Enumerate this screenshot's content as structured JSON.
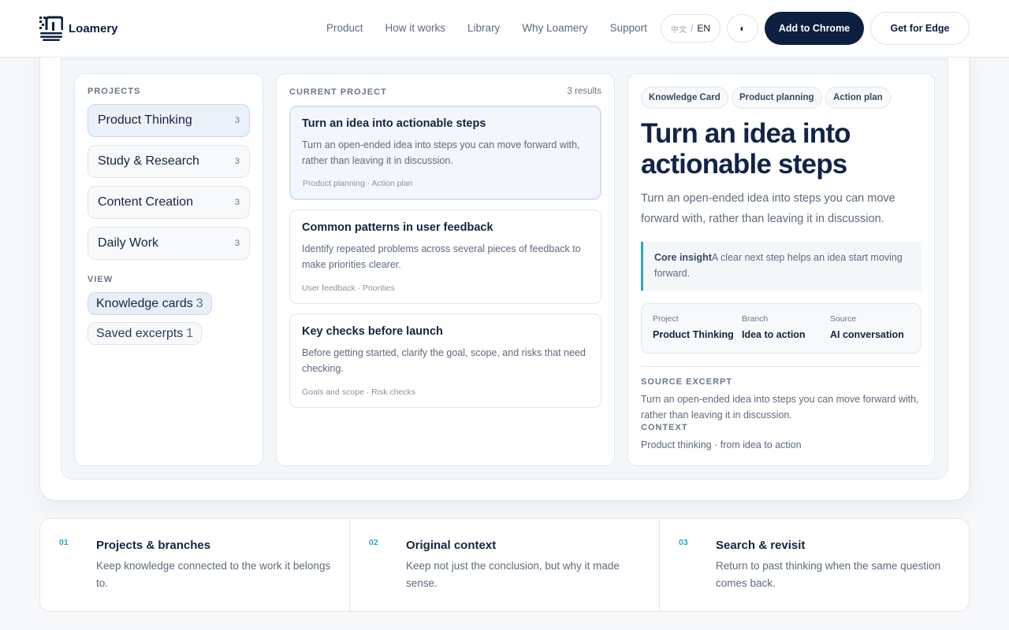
{
  "brand": {
    "name": "Loamery"
  },
  "nav": [
    "Product",
    "How it works",
    "Library",
    "Why Loamery",
    "Support"
  ],
  "language": {
    "other": "中文",
    "separator": "/",
    "current": "EN"
  },
  "theme_toggle": "◐",
  "header_buttons": {
    "chrome": "Add to Chrome",
    "edge": "Get for Edge"
  },
  "projects": {
    "label": "PROJECTS",
    "items": [
      {
        "name": "Product Thinking",
        "count": "3",
        "active": true
      },
      {
        "name": "Study & Research",
        "count": "3",
        "active": false
      },
      {
        "name": "Content Creation",
        "count": "3",
        "active": false
      },
      {
        "name": "Daily Work",
        "count": "3",
        "active": false
      }
    ]
  },
  "view": {
    "label": "VIEW",
    "options": [
      {
        "name": "Knowledge cards",
        "count": "3",
        "active": true
      },
      {
        "name": "Saved excerpts",
        "count": "1",
        "active": false
      }
    ]
  },
  "current_project": {
    "label": "CURRENT PROJECT",
    "results": "3 results",
    "cards": [
      {
        "title": "Turn an idea into actionable steps",
        "description": "Turn an open-ended idea into steps you can move forward with, rather than leaving it in discussion.",
        "meta": "Product planning · Action plan",
        "active": true
      },
      {
        "title": "Common patterns in user feedback",
        "description": "Identify repeated problems across several pieces of feedback to make priorities clearer.",
        "meta": "User feedback · Priorities",
        "active": false
      },
      {
        "title": "Key checks before launch",
        "description": "Before getting started, clarify the goal, scope, and risks that need checking.",
        "meta": "Goals and scope · Risk checks",
        "active": false
      }
    ]
  },
  "detail": {
    "tags": [
      "Knowledge Card",
      "Product planning",
      "Action plan"
    ],
    "title": "Turn an idea into actionable steps",
    "summary": "Turn an open-ended idea into steps you can move forward with, rather than leaving it in discussion.",
    "insight_label": "Core insight",
    "insight_text": "A clear next step helps an idea start moving forward.",
    "meta": [
      {
        "label": "Project",
        "value": "Product Thinking"
      },
      {
        "label": "Branch",
        "value": "Idea to action"
      },
      {
        "label": "Source",
        "value": "AI conversation"
      }
    ],
    "source_label": "SOURCE EXCERPT",
    "source_text": "Turn an open-ended idea into steps you can move forward with, rather than leaving it in discussion.",
    "context_label": "CONTEXT",
    "context_text": "Product thinking · from idea to action"
  },
  "features": [
    {
      "num": "01",
      "title": "Projects & branches",
      "description": "Keep knowledge connected to the work it belongs to."
    },
    {
      "num": "02",
      "title": "Original context",
      "description": "Keep not just the conclusion, but why it made sense."
    },
    {
      "num": "03",
      "title": "Search & revisit",
      "description": "Return to past thinking when the same question comes back."
    }
  ],
  "colors": {
    "navy": "#0d1f3f",
    "accent": "#2fa6c4",
    "active_bg": "#ebf1f9"
  }
}
